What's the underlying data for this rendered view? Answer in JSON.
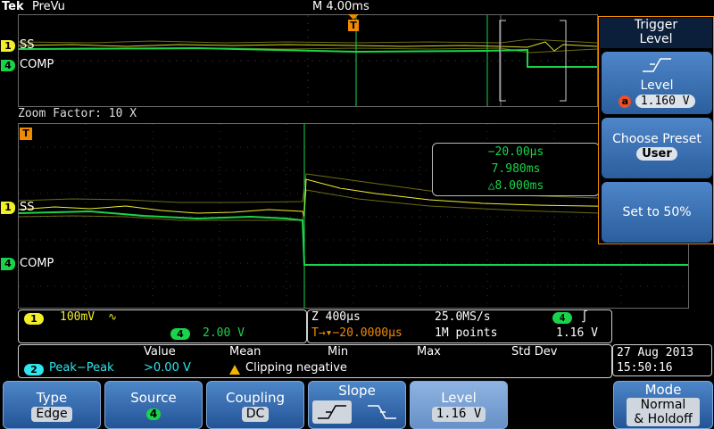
{
  "top_bar": {
    "logo": "Tek",
    "mode": "PreVu",
    "timebase": "M 4.00ms"
  },
  "overview": {
    "trigger_marker": "T",
    "ch1_badge": "1",
    "ch1_label": "SS",
    "ch4_badge": "4",
    "ch4_label": "COMP"
  },
  "zoom": {
    "label": "Zoom Factor: 10 X",
    "trigger_marker": "T",
    "ch1_badge": "1",
    "ch1_label": "SS",
    "ch4_badge": "4",
    "ch4_label": "COMP",
    "cursor_readout": {
      "t1": "−20.00µs",
      "t2": "7.980ms",
      "delta": "△8.000ms"
    }
  },
  "side_menu": {
    "title_line1": "Trigger",
    "title_line2": "Level",
    "level_label": "Level",
    "level_badge": "a",
    "level_value": "1.160 V",
    "preset_label": "Choose Preset",
    "preset_value": "User",
    "set50_label": "Set to 50%"
  },
  "channel_panel": {
    "ch1_badge": "1",
    "ch1_scale": "100mV",
    "ch1_bw": "∿",
    "ch4_badge": "4",
    "ch4_scale": "2.00 V"
  },
  "timebase_panel": {
    "zoom_time": "Z 400µs",
    "sample_rate": "25.0MS/s",
    "trig_src_badge": "4",
    "trig_slope_glyph": "∫",
    "position": "T→▾−20.0000µs",
    "record_length": "1M points",
    "trig_level": "1.16 V"
  },
  "measurement": {
    "headers": [
      "Value",
      "Mean",
      "Min",
      "Max",
      "Std Dev"
    ],
    "badge": "2",
    "name": "Peak−Peak",
    "value": ">0.00 V",
    "warning": "Clipping negative"
  },
  "datetime": {
    "date": "27 Aug 2013",
    "time": "15:50:16"
  },
  "bottom_menu": {
    "type_label": "Type",
    "type_value": "Edge",
    "source_label": "Source",
    "source_value": "4",
    "coupling_label": "Coupling",
    "coupling_value": "DC",
    "slope_label": "Slope",
    "level_label": "Level",
    "level_value": "1.16 V",
    "mode_line1": "Mode",
    "mode_line2": "Normal",
    "mode_line3": "& Holdoff"
  },
  "colors": {
    "ch1": "#f2ef2a",
    "ch4": "#19d44a",
    "ch2": "#2ee6ee",
    "trigger": "#f08a00",
    "menu": "#2f68b0"
  }
}
